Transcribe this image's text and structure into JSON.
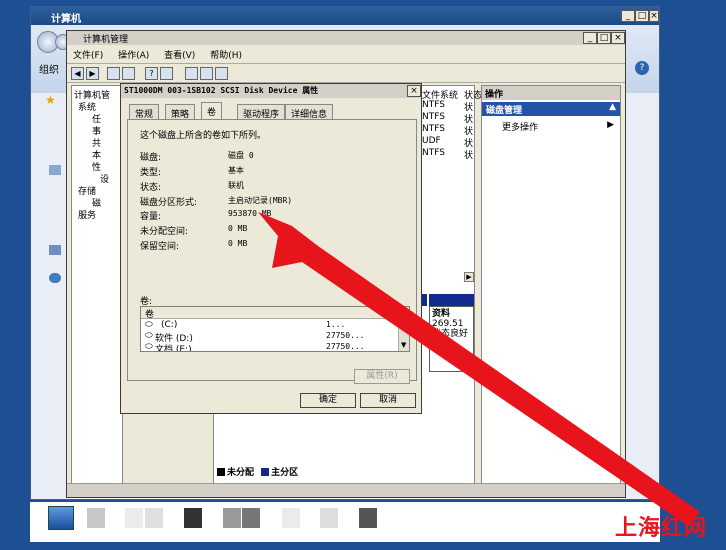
{
  "outer_window": {
    "title": "计算机",
    "organize": "组织"
  },
  "cm_window": {
    "title": "计算机管理",
    "menu": [
      "文件(F)",
      "操作(A)",
      "查看(V)",
      "帮助(H)"
    ],
    "tree": [
      "计算机管",
      "系统",
      "任",
      "事",
      "共",
      "本",
      "性",
      "设",
      "存储",
      "磁",
      "服务"
    ],
    "fs_header": [
      "文件系统",
      "状态"
    ],
    "fs_rows": [
      [
        "NTFS",
        "状"
      ],
      [
        "NTFS",
        "状"
      ],
      [
        "NTFS",
        "状"
      ],
      [
        "UDF",
        "状"
      ],
      [
        "NTFS",
        "状"
      ]
    ],
    "actions": {
      "header": "操作",
      "selected": "磁盘管理",
      "more": "更多操作"
    },
    "disk_box": {
      "name": "资料",
      "size": "269.51",
      "status": "状态良好"
    },
    "legend": {
      "unallocated": "未分配",
      "primary": "主分区"
    }
  },
  "dialog": {
    "title": "ST1000DM 003-1SB102 SCSI Disk Device 属性",
    "tabs": [
      "常规",
      "策略",
      "卷",
      "驱动程序",
      "详细信息"
    ],
    "active_tab": "卷",
    "intro": "这个磁盘上所含的卷如下所列。",
    "fields": [
      {
        "label": "磁盘:",
        "value": "磁盘 0"
      },
      {
        "label": "类型:",
        "value": "基本"
      },
      {
        "label": "状态:",
        "value": "联机"
      },
      {
        "label": "磁盘分区形式:",
        "value": "主启动记录(MBR)"
      },
      {
        "label": "容量:",
        "value": "953870 MB"
      },
      {
        "label": "未分配空间:",
        "value": "0 MB"
      },
      {
        "label": "保留空间:",
        "value": "0 MB"
      }
    ],
    "volumes_label": "卷:",
    "volumes_header": "卷",
    "volumes": [
      {
        "name": "(C:)",
        "size": "1..."
      },
      {
        "name": "软件 (D:)",
        "size": "27750..."
      },
      {
        "name": "文档 (E:)",
        "size": "27750..."
      }
    ],
    "btn_properties": "属性(R)",
    "btn_ok": "确定",
    "btn_cancel": "取消"
  },
  "watermark": "上海红网",
  "colors": {
    "arrow": "#e8141c",
    "selection": "#2453a8",
    "primary_partition": "#122a8f"
  }
}
